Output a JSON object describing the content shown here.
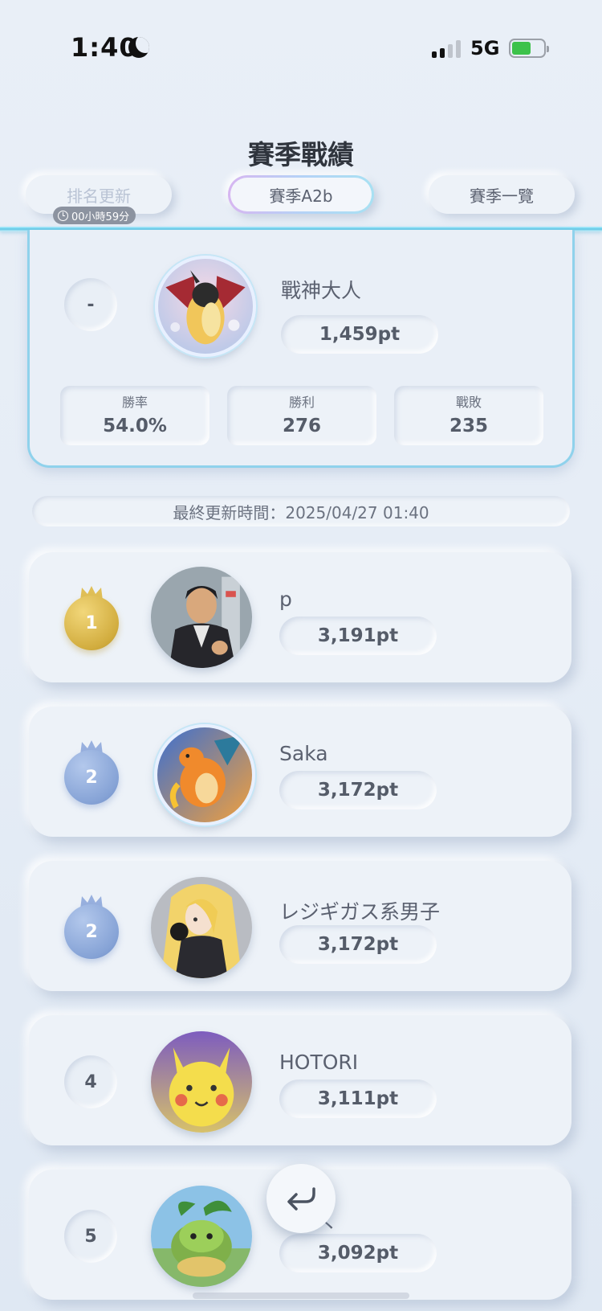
{
  "status_bar": {
    "time": "1:40",
    "network": "5G"
  },
  "header": {
    "title": "賽季戰績",
    "update_button": "排名更新",
    "timer": "00小時59分",
    "season_button": "賽季A2b",
    "season_list_button": "賽季一覽"
  },
  "my_record": {
    "rank": "-",
    "name": "戰神大人",
    "points": "1,459pt",
    "stats": [
      {
        "label": "勝率",
        "value": "54.0%"
      },
      {
        "label": "勝利",
        "value": "276"
      },
      {
        "label": "戰敗",
        "value": "235"
      }
    ]
  },
  "last_updated": "最終更新時間：2025/04/27 01:40",
  "ranking": [
    {
      "rank": "1",
      "medal": "gold",
      "name": "p",
      "points": "3,191pt"
    },
    {
      "rank": "2",
      "medal": "silver",
      "name": "Saka",
      "points": "3,172pt"
    },
    {
      "rank": "2",
      "medal": "silver",
      "name": "レジギガス系男子",
      "points": "3,172pt"
    },
    {
      "rank": "4",
      "medal": "none",
      "name": "HOTORI",
      "points": "3,111pt"
    },
    {
      "rank": "5",
      "medal": "none",
      "name": "こっく",
      "points": "3,092pt"
    }
  ],
  "icons": {
    "moon": "moon-icon",
    "clock": "clock-icon",
    "crown": "crown-icon",
    "back": "return-arrow-icon"
  },
  "colors": {
    "accent_line": "#5fc8e6",
    "gold": "#d2ad3f",
    "silver": "#86a3d6",
    "text": "#5b6170"
  }
}
